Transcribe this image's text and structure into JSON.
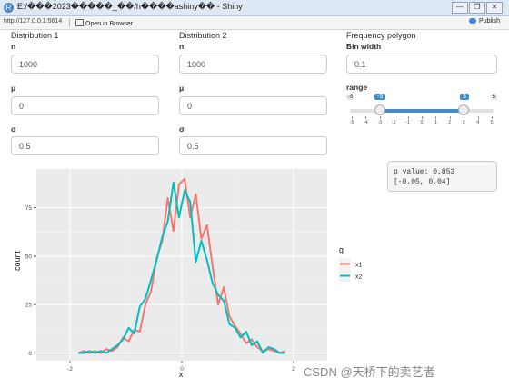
{
  "window": {
    "title": "E:/���2023�����_��/h����ashiny�� - Shiny",
    "minimize": "—",
    "restore": "❐",
    "close": "✕"
  },
  "toolbar": {
    "url": "http://127.0.0.1:5614",
    "open_in_browser": "Open in Browser",
    "publish": "Publish"
  },
  "dist1": {
    "title": "Distribution 1",
    "n_label": "n",
    "n_value": "1000",
    "mu_label": "μ",
    "mu_value": "0",
    "sigma_label": "σ",
    "sigma_value": "0.5"
  },
  "dist2": {
    "title": "Distribution 2",
    "n_label": "n",
    "n_value": "1000",
    "mu_label": "μ",
    "mu_value": "0",
    "sigma_label": "σ",
    "sigma_value": "0.5"
  },
  "freq": {
    "title": "Frequency polygon",
    "bin_label": "Bin width",
    "bin_value": "0.1",
    "range_label": "range",
    "range_min": "-5",
    "range_max": "5",
    "range_low": "-3",
    "range_high": "3",
    "ticks": [
      "-5",
      "-4",
      "-3",
      "-2",
      "-1",
      "0",
      "1",
      "2",
      "3",
      "4",
      "5"
    ]
  },
  "output": {
    "line1": "p value: 0.853",
    "line2": "[-0.05, 0.04]"
  },
  "watermark": "CSDN @天桥下的卖艺者",
  "chart_data": {
    "type": "line",
    "xlabel": "x",
    "ylabel": "count",
    "xlim": [
      -2.6,
      2.6
    ],
    "ylim": [
      -4,
      95
    ],
    "xticks": [
      "-2",
      "0",
      "2"
    ],
    "yticks": [
      "0",
      "25",
      "50",
      "75"
    ],
    "legend_title": "g",
    "legend_position": "right",
    "grid": true,
    "series": [
      {
        "name": "x1",
        "color": "#F8766D",
        "x": [
          -1.85,
          -1.75,
          -1.65,
          -1.55,
          -1.45,
          -1.35,
          -1.25,
          -1.15,
          -1.05,
          -0.95,
          -0.85,
          -0.75,
          -0.65,
          -0.55,
          -0.45,
          -0.35,
          -0.25,
          -0.15,
          -0.05,
          0.05,
          0.15,
          0.25,
          0.35,
          0.45,
          0.55,
          0.65,
          0.75,
          0.85,
          0.95,
          1.05,
          1.15,
          1.25,
          1.35,
          1.45,
          1.55,
          1.65,
          1.75,
          1.85
        ],
        "y": [
          0,
          1,
          0,
          1,
          0,
          2,
          1,
          3,
          8,
          6,
          12,
          11,
          25,
          32,
          49,
          58,
          80,
          63,
          87,
          90,
          70,
          82,
          59,
          66,
          45,
          25,
          34,
          19,
          14,
          10,
          5,
          7,
          3,
          1,
          2,
          1,
          0,
          1
        ]
      },
      {
        "name": "x2",
        "color": "#00BFC4",
        "x": [
          -1.85,
          -1.75,
          -1.65,
          -1.55,
          -1.45,
          -1.35,
          -1.25,
          -1.15,
          -1.05,
          -0.95,
          -0.85,
          -0.75,
          -0.65,
          -0.55,
          -0.45,
          -0.35,
          -0.25,
          -0.15,
          -0.05,
          0.05,
          0.15,
          0.25,
          0.35,
          0.45,
          0.55,
          0.65,
          0.75,
          0.85,
          0.95,
          1.05,
          1.15,
          1.25,
          1.35,
          1.45,
          1.55,
          1.65,
          1.75,
          1.85
        ],
        "y": [
          0,
          0,
          1,
          0,
          1,
          0,
          2,
          4,
          7,
          13,
          10,
          24,
          28,
          38,
          48,
          60,
          68,
          88,
          70,
          84,
          78,
          47,
          58,
          48,
          36,
          30,
          27,
          15,
          13,
          8,
          11,
          4,
          6,
          0,
          3,
          2,
          0,
          0
        ]
      }
    ]
  }
}
